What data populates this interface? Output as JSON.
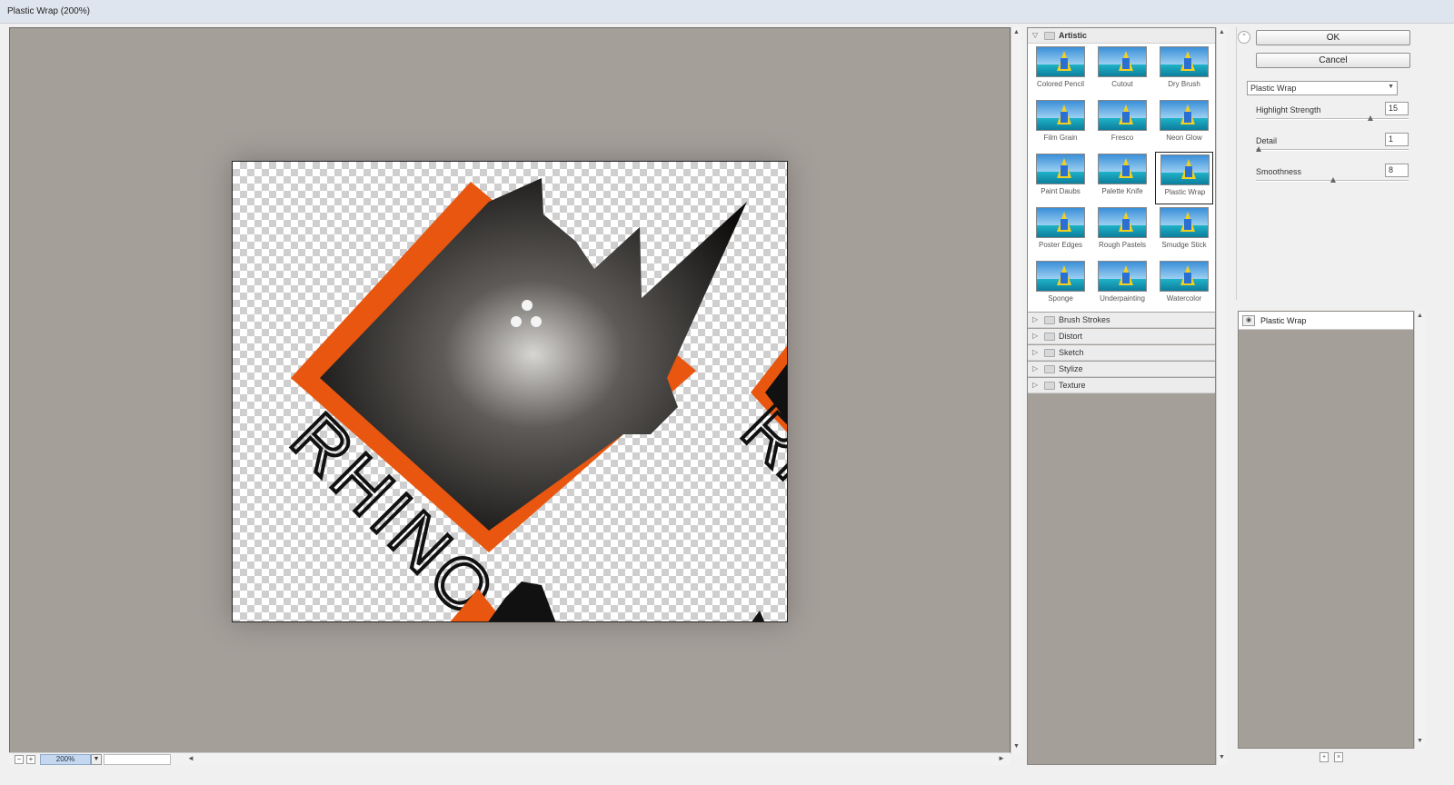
{
  "window": {
    "title": "Plastic Wrap (200%)"
  },
  "preview": {
    "zoom": "200%",
    "artwork_text": "RHINO",
    "accent_color": "#e8560f"
  },
  "gallery": {
    "artistic_label": "Artistic",
    "filters": [
      "Colored Pencil",
      "Cutout",
      "Dry Brush",
      "Film Grain",
      "Fresco",
      "Neon Glow",
      "Paint Daubs",
      "Palette Knife",
      "Plastic Wrap",
      "Poster Edges",
      "Rough Pastels",
      "Smudge Stick",
      "Sponge",
      "Underpainting",
      "Watercolor"
    ],
    "selected": "Plastic Wrap",
    "categories": [
      "Brush Strokes",
      "Distort",
      "Sketch",
      "Stylize",
      "Texture"
    ]
  },
  "controls": {
    "ok_label": "OK",
    "cancel_label": "Cancel",
    "filter_select": "Plastic Wrap",
    "params": [
      {
        "label": "Highlight Strength",
        "value": "15",
        "fraction": 0.75
      },
      {
        "label": "Detail",
        "value": "1",
        "fraction": 0.0
      },
      {
        "label": "Smoothness",
        "value": "8",
        "fraction": 0.5
      }
    ]
  },
  "layers": {
    "items": [
      "Plastic Wrap"
    ]
  },
  "icons": [
    "collapse-icon",
    "eye-icon",
    "new-layer-icon",
    "trash-icon",
    "folder-icon"
  ]
}
